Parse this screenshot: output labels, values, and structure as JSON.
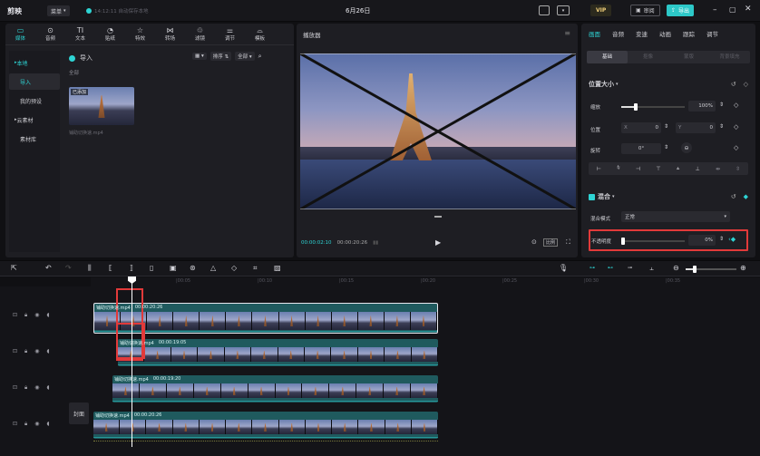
{
  "title_bar": {
    "app_name": "剪映",
    "menu_label": "菜单",
    "autosave": "14:12:11 自动保存本地",
    "project_title": "6月26日",
    "vip_label": "VIP",
    "review_label": "审阅",
    "export_label": "导出"
  },
  "toolbar": {
    "items": [
      {
        "label": "媒体",
        "icon": "media-icon"
      },
      {
        "label": "音频",
        "icon": "audio-icon"
      },
      {
        "label": "文本",
        "icon": "text-icon"
      },
      {
        "label": "贴纸",
        "icon": "sticker-icon"
      },
      {
        "label": "特效",
        "icon": "effects-icon"
      },
      {
        "label": "转场",
        "icon": "transition-icon"
      },
      {
        "label": "滤镜",
        "icon": "filter-icon"
      },
      {
        "label": "调节",
        "icon": "adjust-icon"
      },
      {
        "label": "模板",
        "icon": "template-icon"
      }
    ]
  },
  "media_sidebar": {
    "items": [
      "本地",
      "导入",
      "我的预设",
      "云素材",
      "素材库"
    ]
  },
  "media_panel": {
    "import_label": "导入",
    "filter_all": "全部",
    "sort_label": "排序",
    "all_label": "全部",
    "clip_badge": "已添加",
    "clip_name": "铺助切换速.mp4"
  },
  "player": {
    "title": "播放器",
    "current_time": "00:00:02:10",
    "total_time": "00:00:20:26",
    "ratio_label": "比例"
  },
  "inspector": {
    "tabs": [
      "画面",
      "音频",
      "变速",
      "动画",
      "跟踪",
      "调节"
    ],
    "subtabs": [
      "基础",
      "抠像",
      "蒙版",
      "背景填充"
    ],
    "position_size": "位置大小",
    "scale_label": "缩放",
    "scale_value": "100%",
    "position_label": "位置",
    "pos_x_label": "X",
    "pos_x": "0",
    "pos_y_label": "Y",
    "pos_y": "0",
    "rotate_label": "旋转",
    "rotate_value": "0°",
    "blend_label": "混合",
    "blend_mode_label": "混合模式",
    "blend_mode_value": "正常",
    "opacity_label": "不透明度",
    "opacity_value": "0%"
  },
  "timeline": {
    "ruler": [
      "|00:05",
      "|00:10",
      "|00:15",
      "|00:20",
      "|00:25",
      "|00:30",
      "|00:35"
    ],
    "cover_label": "封面",
    "tracks": [
      {
        "clip_name": "铺助切换速.mp4",
        "clip_time": "00:00:20:26"
      },
      {
        "clip_name": "铺助切换速.mp4",
        "clip_time": "00:00:19:05"
      },
      {
        "clip_name": "铺助切换速.mp4",
        "clip_time": "00:00:19:20"
      },
      {
        "clip_name": "铺助切换速.mp4",
        "clip_time": "00:00:20:26"
      }
    ]
  },
  "colors": {
    "accent": "#2ed4d4",
    "highlight": "#e23a3a",
    "export": "#2dc8c8"
  }
}
